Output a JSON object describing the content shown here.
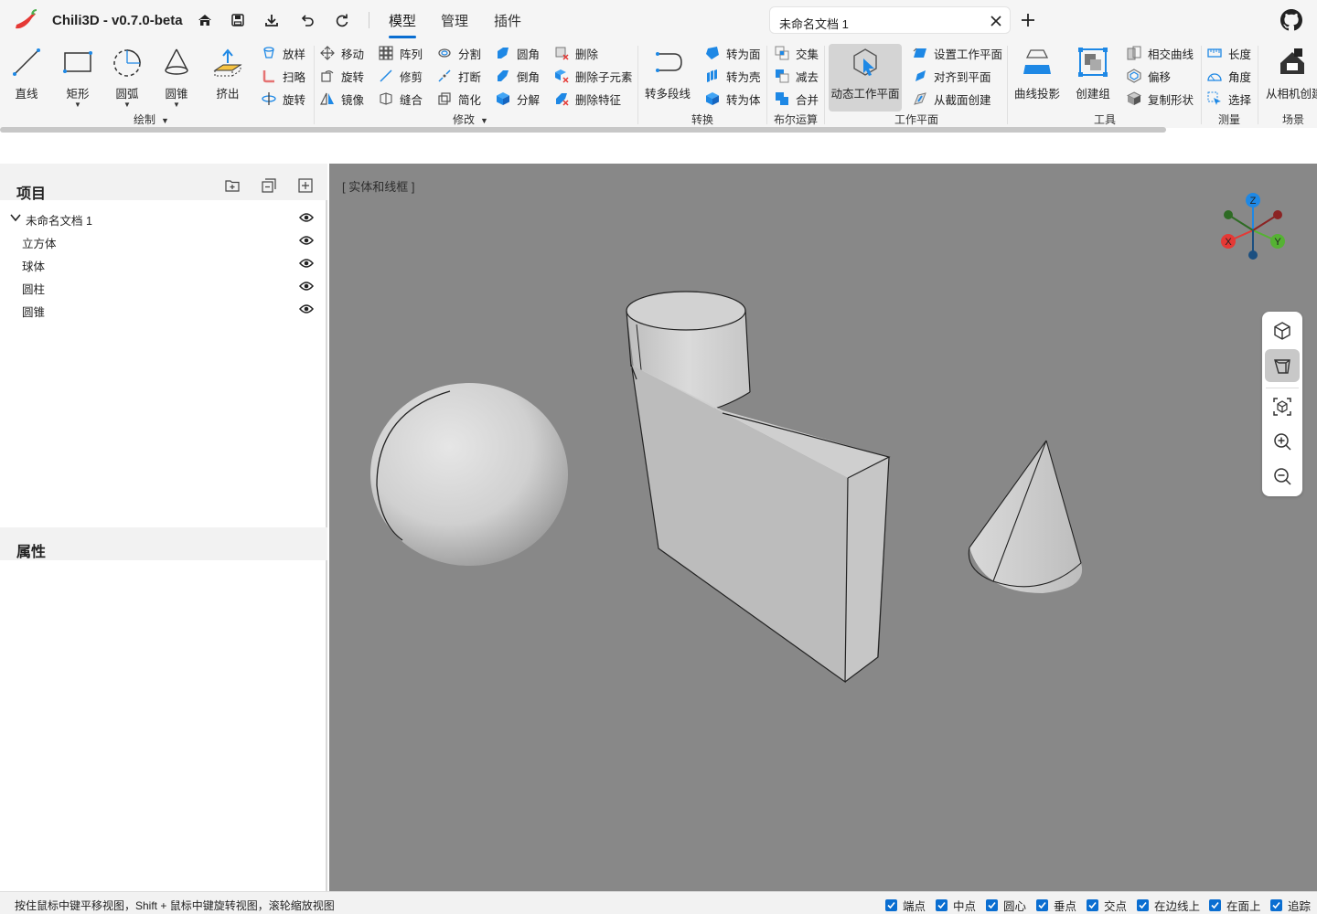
{
  "app": {
    "title": "Chili3D - v0.7.0-beta"
  },
  "menu_tabs": [
    {
      "label": "模型"
    },
    {
      "label": "管理"
    },
    {
      "label": "插件"
    }
  ],
  "document_tab": {
    "label": "未命名文档 1"
  },
  "ribbon": {
    "draw": {
      "label": "绘制",
      "line": "直线",
      "rect": "矩形",
      "arc": "圆弧",
      "cone": "圆锥",
      "extrude": "挤出",
      "loft": "放样",
      "sweep": "扫略",
      "revolve": "旋转"
    },
    "modify": {
      "label": "修改",
      "move": "移动",
      "rotate": "旋转",
      "mirror": "镜像",
      "array": "阵列",
      "trim": "修剪",
      "sew": "缝合",
      "split": "分割",
      "break": "打断",
      "simplify": "简化",
      "fillet": "圆角",
      "chamfer": "倒角",
      "explode": "分解",
      "delete": "删除",
      "delete_sub": "删除子元素",
      "delete_feature": "删除特征"
    },
    "convert": {
      "label": "转换",
      "polyline": "转多段线",
      "to_face": "转为面",
      "to_shell": "转为壳",
      "to_solid": "转为体"
    },
    "boolean": {
      "label": "布尔运算",
      "intersect": "交集",
      "subtract": "减去",
      "union": "合并"
    },
    "workplane": {
      "label": "工作平面",
      "dynamic": "动态工作平面",
      "set": "设置工作平面",
      "align": "对齐到平面",
      "from_section": "从截面创建"
    },
    "tools": {
      "label": "工具",
      "project": "曲线投影",
      "group": "创建组",
      "intersect_curve": "相交曲线",
      "offset": "偏移",
      "copy_shape": "复制形状"
    },
    "measure": {
      "label": "测量",
      "length": "长度",
      "angle": "角度",
      "select": "选择"
    },
    "scene": {
      "label": "场景",
      "from_camera": "从相机创建"
    }
  },
  "project_panel": {
    "title": "项目",
    "root": "未命名文档 1",
    "items": [
      {
        "label": "立方体"
      },
      {
        "label": "球体"
      },
      {
        "label": "圆柱"
      },
      {
        "label": "圆锥"
      }
    ]
  },
  "properties_panel": {
    "title": "属性"
  },
  "viewport": {
    "mode_label": "[ 实体和线框 ]",
    "background": "#888888",
    "axes": {
      "x": "X",
      "y": "Y",
      "z": "Z"
    }
  },
  "status": {
    "hint": "按住鼠标中键平移视图，Shift + 鼠标中键旋转视图，滚轮缩放视图",
    "snaps": [
      {
        "label": "端点"
      },
      {
        "label": "中点"
      },
      {
        "label": "圆心"
      },
      {
        "label": "垂点"
      },
      {
        "label": "交点"
      },
      {
        "label": "在边线上"
      },
      {
        "label": "在面上"
      },
      {
        "label": "追踪"
      }
    ]
  },
  "colors": {
    "accent": "#0a6ed1",
    "axis_x": "#e53935",
    "axis_y": "#55b233",
    "axis_z": "#1e88e5",
    "logo": "#e53935"
  }
}
